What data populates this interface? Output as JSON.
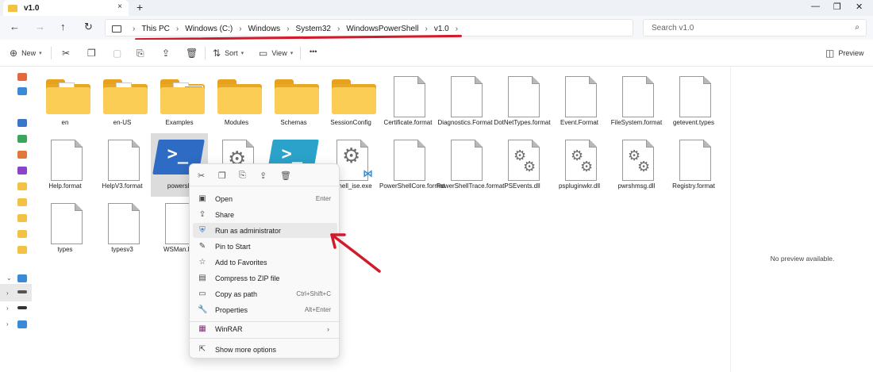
{
  "window": {
    "tab_title": "v1.0",
    "tab_close": "×",
    "new_tab": "+",
    "minimize": "—",
    "maximize": "❐",
    "close": "✕"
  },
  "nav": {
    "back": "←",
    "forward": "→",
    "up": "↑",
    "refresh": "↻"
  },
  "breadcrumb": [
    "This PC",
    "Windows (C:)",
    "Windows",
    "System32",
    "WindowsPowerShell",
    "v1.0"
  ],
  "search": {
    "placeholder": "Search v1.0"
  },
  "toolbar": {
    "new_label": "New",
    "sort_label": "Sort",
    "view_label": "View",
    "more_label": "•••",
    "preview_label": "Preview"
  },
  "files": [
    {
      "label": "en",
      "kind": "folder-doc"
    },
    {
      "label": "en-US",
      "kind": "folder-doc"
    },
    {
      "label": "Examples",
      "kind": "folder-img"
    },
    {
      "label": "Modules",
      "kind": "folder"
    },
    {
      "label": "Schemas",
      "kind": "folder"
    },
    {
      "label": "SessionConfig",
      "kind": "folder"
    },
    {
      "label": "Certificate.format",
      "kind": "doc"
    },
    {
      "label": "Diagnostics.Format",
      "kind": "doc"
    },
    {
      "label": "DotNetTypes.format",
      "kind": "doc"
    },
    {
      "label": "Event.Format",
      "kind": "doc"
    },
    {
      "label": "FileSystem.format",
      "kind": "doc"
    },
    {
      "label": "getevent.types",
      "kind": "doc"
    },
    {
      "label": "Help.format",
      "kind": "doc"
    },
    {
      "label": "HelpV3.format",
      "kind": "doc"
    },
    {
      "label": "powersh",
      "kind": "ps"
    },
    {
      "label": "",
      "kind": "gear-doc"
    },
    {
      "label": "",
      "kind": "ps-teal"
    },
    {
      "label": "ershell_ise.exe",
      "kind": "gear-vs"
    },
    {
      "label": "PowerShellCore.format",
      "kind": "doc"
    },
    {
      "label": "PowerShellTrace.format",
      "kind": "doc"
    },
    {
      "label": "PSEvents.dll",
      "kind": "dll"
    },
    {
      "label": "pspluginwkr.dll",
      "kind": "dll"
    },
    {
      "label": "pwrshmsg.dll",
      "kind": "dll"
    },
    {
      "label": "Registry.format",
      "kind": "doc"
    },
    {
      "label": "types",
      "kind": "doc"
    },
    {
      "label": "typesv3",
      "kind": "doc"
    },
    {
      "label": "WSMan.Fo",
      "kind": "doc"
    }
  ],
  "context_menu": {
    "items": [
      {
        "label": "Open",
        "shortcut": "Enter",
        "icon": "open-icon"
      },
      {
        "label": "Share",
        "shortcut": "",
        "icon": "share-icon"
      },
      {
        "label": "Run as administrator",
        "shortcut": "",
        "icon": "shield-icon"
      },
      {
        "label": "Pin to Start",
        "shortcut": "",
        "icon": "pin-icon"
      },
      {
        "label": "Add to Favorites",
        "shortcut": "",
        "icon": "star-icon"
      },
      {
        "label": "Compress to ZIP file",
        "shortcut": "",
        "icon": "zip-icon"
      },
      {
        "label": "Copy as path",
        "shortcut": "Ctrl+Shift+C",
        "icon": "path-icon"
      },
      {
        "label": "Properties",
        "shortcut": "Alt+Enter",
        "icon": "wrench-icon"
      },
      {
        "label": "WinRAR",
        "shortcut": "",
        "icon": "winrar-icon"
      },
      {
        "label": "Show more options",
        "shortcut": "",
        "icon": "more-options-icon"
      }
    ]
  },
  "preview_pane": {
    "message": "No preview available."
  },
  "colors": {
    "accent": "#d11a2a",
    "folder": "#fbcd55",
    "powershell": "#2d6bc4"
  }
}
